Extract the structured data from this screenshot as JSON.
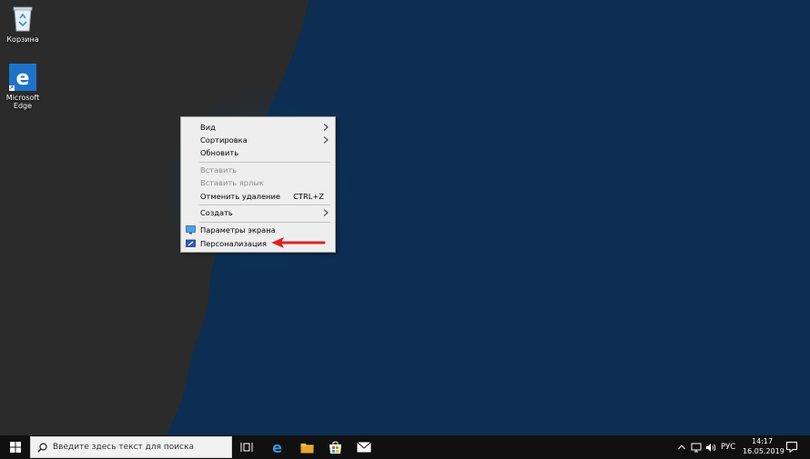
{
  "desktop": {
    "icons": [
      {
        "label": "Корзина"
      },
      {
        "label": "Microsoft\nEdge"
      }
    ]
  },
  "context_menu": {
    "items": [
      {
        "label": "Вид",
        "submenu": true
      },
      {
        "label": "Сортировка",
        "submenu": true
      },
      {
        "label": "Обновить"
      },
      {
        "label": "Вставить",
        "disabled": true
      },
      {
        "label": "Вставить ярлык",
        "disabled": true
      },
      {
        "label": "Отменить удаление",
        "shortcut": "CTRL+Z"
      },
      {
        "label": "Создать",
        "submenu": true
      },
      {
        "label": "Параметры экрана",
        "icon": "display-settings-icon"
      },
      {
        "label": "Персонализация",
        "icon": "personalization-icon",
        "annotated": true
      }
    ]
  },
  "taskbar": {
    "search_placeholder": "Введите здесь текст для поиска",
    "language": "РУС",
    "time": "14:17",
    "date": "16.05.2019"
  },
  "colors": {
    "wallpaper_blue": "#0b2e52",
    "wallpaper_dark": "#2b2b2b",
    "annotation_arrow": "#e02020",
    "taskbar": "#101010"
  }
}
